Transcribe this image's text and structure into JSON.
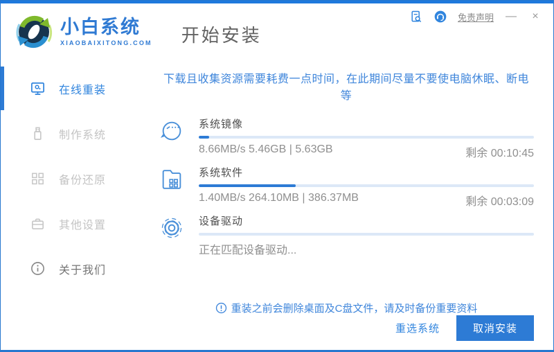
{
  "window": {
    "brand_name": "小白系统",
    "brand_domain": "XIAOBAIXITONG.COM",
    "page_title": "开始安装",
    "disclaimer_link": "免责声明",
    "minimize_label": "—",
    "close_label": "×"
  },
  "sidebar": {
    "items": [
      {
        "label": "在线重装",
        "active": true,
        "icon": "monitor-icon"
      },
      {
        "label": "制作系统",
        "active": false,
        "icon": "usb-icon"
      },
      {
        "label": "备份还原",
        "active": false,
        "icon": "blocks-icon"
      },
      {
        "label": "其他设置",
        "active": false,
        "icon": "toolbox-icon"
      },
      {
        "label": "关于我们",
        "active": false,
        "icon": "info-icon"
      }
    ]
  },
  "main": {
    "warning": "下载且收集资源需要耗费一点时间，在此期间尽量不要使电脑休眠、断电等",
    "tasks": [
      {
        "title": "系统镜像",
        "icon": "face-bubble-icon",
        "progress_percent": 3,
        "stats": "8.66MB/s 5.46GB | 5.63GB",
        "remaining": "剩余 00:10:45"
      },
      {
        "title": "系统软件",
        "icon": "folder-apps-icon",
        "progress_percent": 29,
        "stats": "1.40MB/s 264.10MB | 386.37MB",
        "remaining": "剩余 00:03:09"
      },
      {
        "title": "设备驱动",
        "icon": "gear-icon",
        "progress_percent": 0,
        "stats": "正在匹配设备驱动...",
        "remaining": ""
      }
    ],
    "notice": "重装之前会删除桌面及C盘文件，请及时备份重要资料"
  },
  "footer": {
    "reselect_label": "重选系统",
    "cancel_label": "取消安装"
  },
  "colors": {
    "accent_blue": "#2d7bd5",
    "active_blue": "#3185de",
    "track_blue": "#dce8f7",
    "warning_blue": "#3f86db",
    "top_strip": "#1e79dd"
  }
}
